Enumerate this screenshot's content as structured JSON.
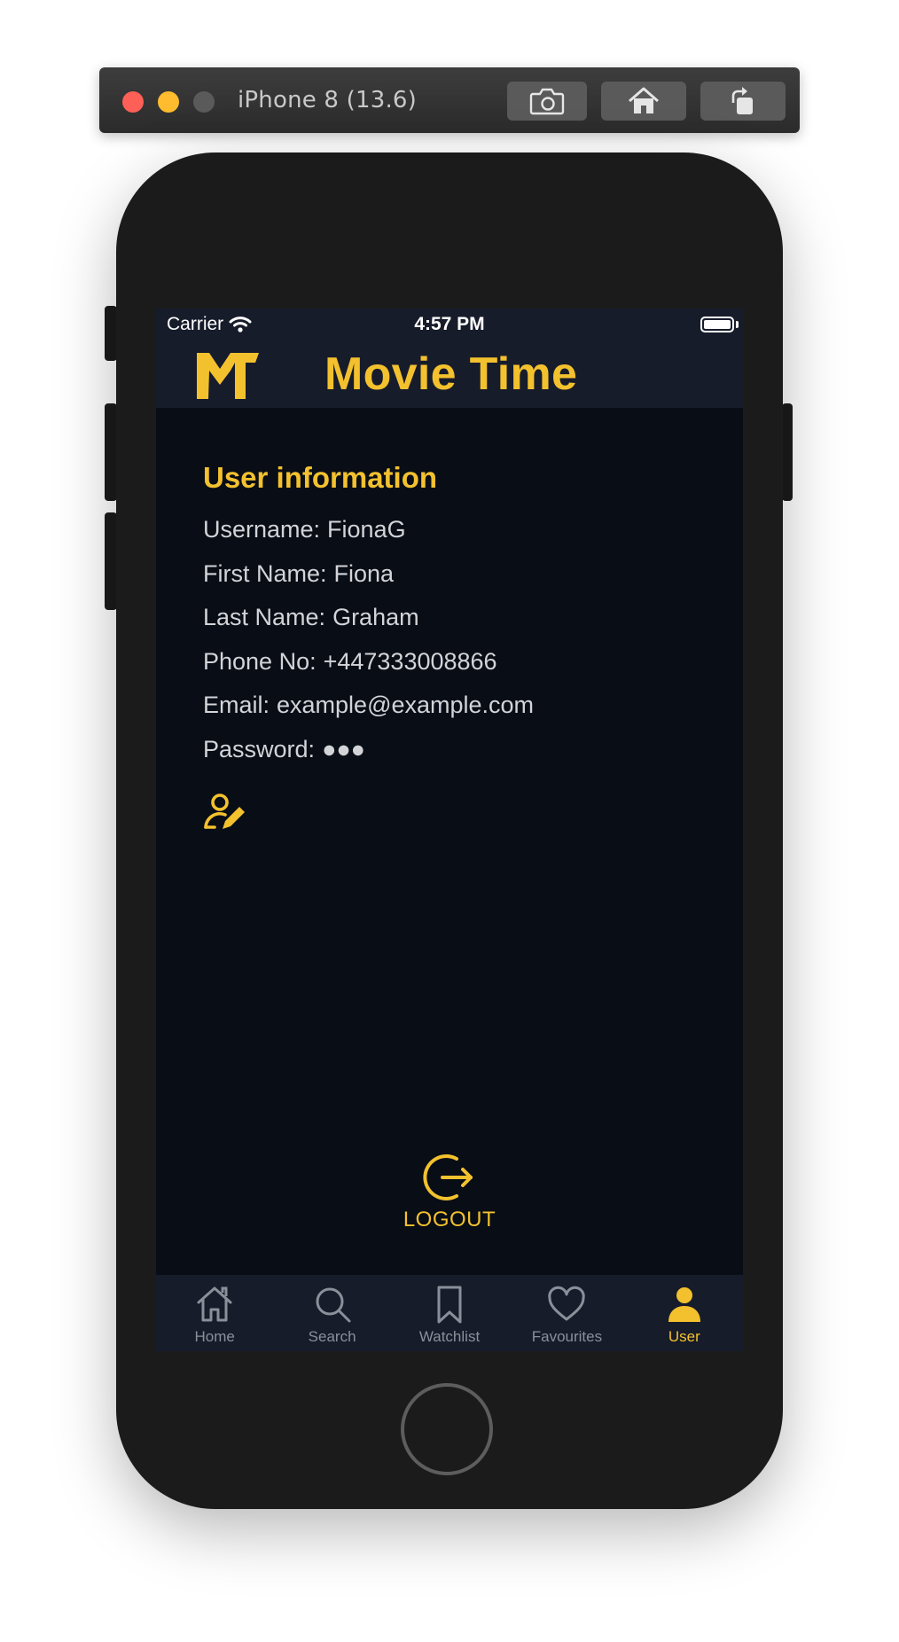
{
  "simulator": {
    "device_title": "iPhone 8 (13.6)",
    "toolbar_buttons": [
      {
        "icon": "camera-icon",
        "name": "screenshot"
      },
      {
        "icon": "home-icon",
        "name": "home"
      },
      {
        "icon": "rotate-icon",
        "name": "rotate"
      }
    ]
  },
  "status_bar": {
    "carrier": "Carrier",
    "time": "4:57 PM",
    "battery_level": 1.0
  },
  "header": {
    "app_title": "Movie Time",
    "logo_icon": "mt-logo-icon"
  },
  "user_info": {
    "title": "User information",
    "rows": [
      {
        "label": "Username:",
        "value": "FionaG"
      },
      {
        "label": "First Name:",
        "value": "Fiona"
      },
      {
        "label": "Last Name:",
        "value": "Graham"
      },
      {
        "label": "Phone No:",
        "value": "+447333008866"
      },
      {
        "label": "Email:",
        "value": "example@example.com"
      },
      {
        "label": "Password:",
        "value": "●●●"
      }
    ],
    "edit_icon": "user-edit-icon"
  },
  "logout": {
    "label": "LOGOUT",
    "icon": "logout-icon"
  },
  "tab_bar": {
    "tabs": [
      {
        "label": "Home",
        "icon": "home-icon",
        "active": false
      },
      {
        "label": "Search",
        "icon": "search-icon",
        "active": false
      },
      {
        "label": "Watchlist",
        "icon": "bookmark-icon",
        "active": false
      },
      {
        "label": "Favourites",
        "icon": "heart-icon",
        "active": false
      },
      {
        "label": "User",
        "icon": "user-icon",
        "active": true
      }
    ]
  },
  "colors": {
    "accent": "#f3c12e",
    "screen_background": "#080d16",
    "header_background": "#171c2b",
    "text_secondary": "#d2d4d8",
    "tab_inactive": "#8b8f99"
  }
}
